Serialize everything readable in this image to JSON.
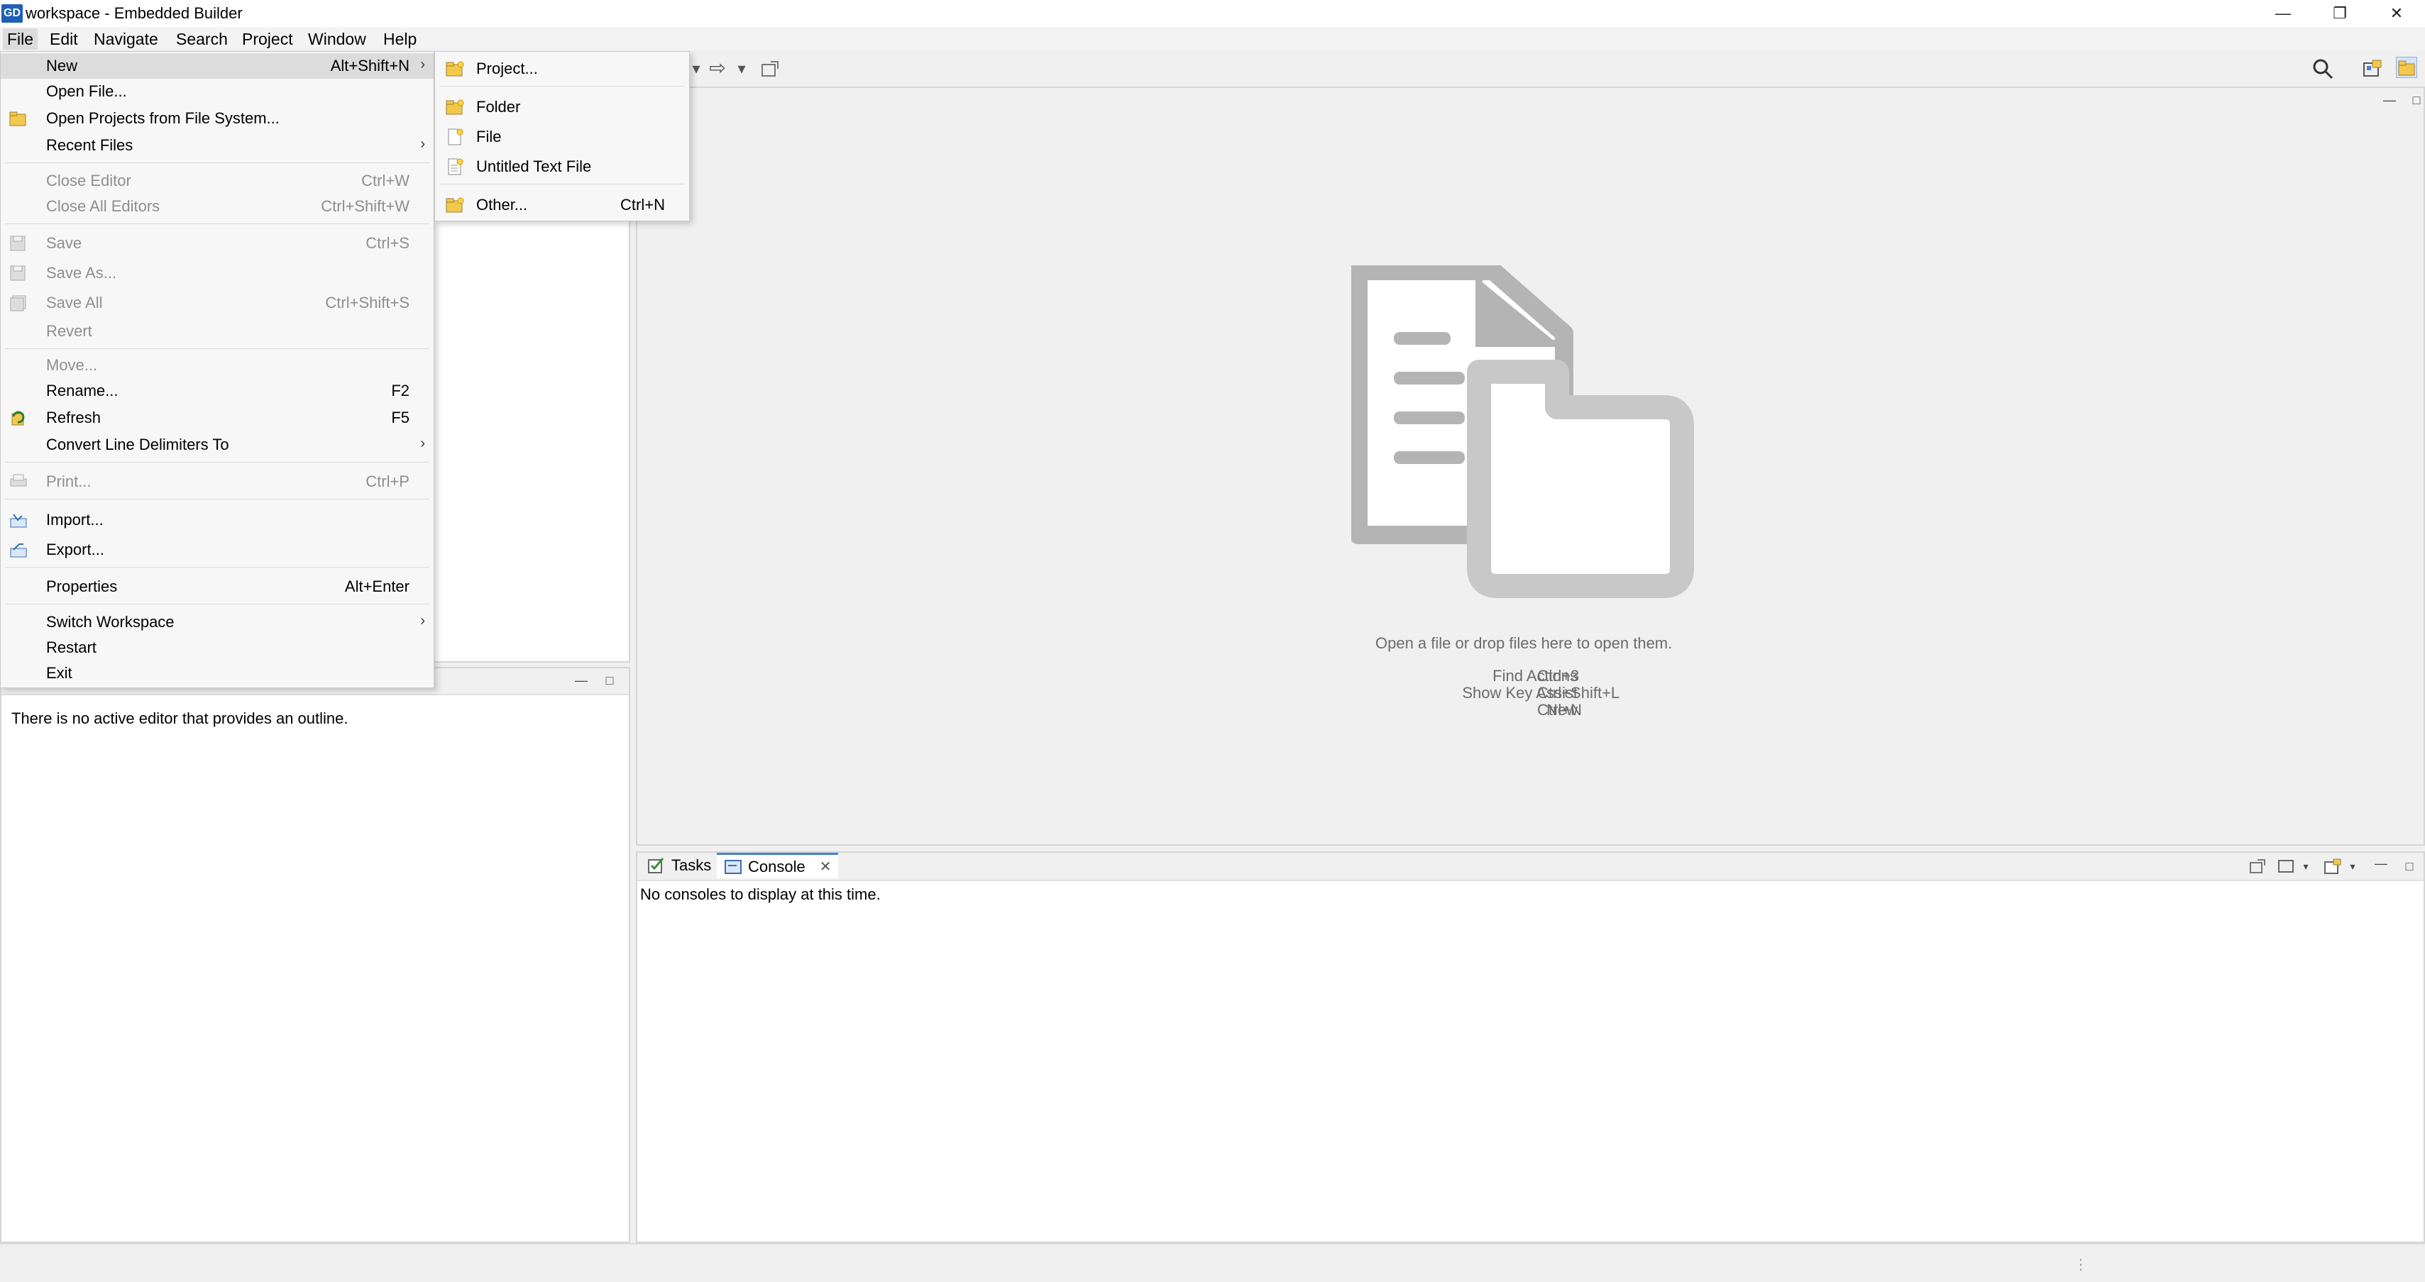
{
  "window": {
    "app_badge": "GD",
    "title": "workspace - Embedded Builder"
  },
  "menubar": {
    "items": [
      "File",
      "Edit",
      "Navigate",
      "Search",
      "Project",
      "Window",
      "Help"
    ]
  },
  "file_menu": {
    "items": [
      {
        "label": "New",
        "accel": "Alt+Shift+N",
        "submenu": true,
        "enabled": true
      },
      {
        "label": "Open File...",
        "accel": "",
        "enabled": true
      },
      {
        "label": "Open Projects from File System...",
        "accel": "",
        "enabled": true,
        "icon": "folder-open-icon"
      },
      {
        "label": "Recent Files",
        "accel": "",
        "submenu": true,
        "enabled": true
      },
      {
        "label": "Close Editor",
        "accel": "Ctrl+W",
        "enabled": false
      },
      {
        "label": "Close All Editors",
        "accel": "Ctrl+Shift+W",
        "enabled": false
      },
      {
        "label": "Save",
        "accel": "Ctrl+S",
        "enabled": false,
        "icon": "save-icon"
      },
      {
        "label": "Save As...",
        "accel": "",
        "enabled": false,
        "icon": "save-as-icon"
      },
      {
        "label": "Save All",
        "accel": "Ctrl+Shift+S",
        "enabled": false,
        "icon": "save-all-icon"
      },
      {
        "label": "Revert",
        "accel": "",
        "enabled": false
      },
      {
        "label": "Move...",
        "accel": "",
        "enabled": false
      },
      {
        "label": "Rename...",
        "accel": "F2",
        "enabled": true
      },
      {
        "label": "Refresh",
        "accel": "F5",
        "enabled": true,
        "icon": "refresh-icon"
      },
      {
        "label": "Convert Line Delimiters To",
        "accel": "",
        "submenu": true,
        "enabled": true
      },
      {
        "label": "Print...",
        "accel": "Ctrl+P",
        "enabled": false,
        "icon": "print-icon"
      },
      {
        "label": "Import...",
        "accel": "",
        "enabled": true,
        "icon": "import-icon"
      },
      {
        "label": "Export...",
        "accel": "",
        "enabled": true,
        "icon": "export-icon"
      },
      {
        "label": "Properties",
        "accel": "Alt+Enter",
        "enabled": true
      },
      {
        "label": "Switch Workspace",
        "accel": "",
        "submenu": true,
        "enabled": true
      },
      {
        "label": "Restart",
        "accel": "",
        "enabled": true
      },
      {
        "label": "Exit",
        "accel": "",
        "enabled": true
      }
    ]
  },
  "new_submenu": {
    "items": [
      {
        "label": "Project...",
        "accel": ""
      },
      {
        "label": "Folder",
        "accel": ""
      },
      {
        "label": "File",
        "accel": ""
      },
      {
        "label": "Untitled Text File",
        "accel": ""
      },
      {
        "label": "Other...",
        "accel": "Ctrl+N"
      }
    ]
  },
  "outline": {
    "message": "There is no active editor that provides an outline."
  },
  "editor": {
    "drop_hint": "Open a file or drop files here to open them.",
    "shortcuts": [
      {
        "label": "Find Actions",
        "key": "Ctrl+3"
      },
      {
        "label": "Show Key Assist",
        "key": "Ctrl+Shift+L"
      },
      {
        "label": "New",
        "key": "Ctrl+N"
      }
    ]
  },
  "console_panel": {
    "tabs": [
      "Tasks",
      "Console"
    ],
    "message": "No consoles to display at this time."
  },
  "colors": {
    "accent": "#4a7fd0",
    "disabled_text": "#8e8e8e",
    "illustration": "#b4b4b4"
  }
}
